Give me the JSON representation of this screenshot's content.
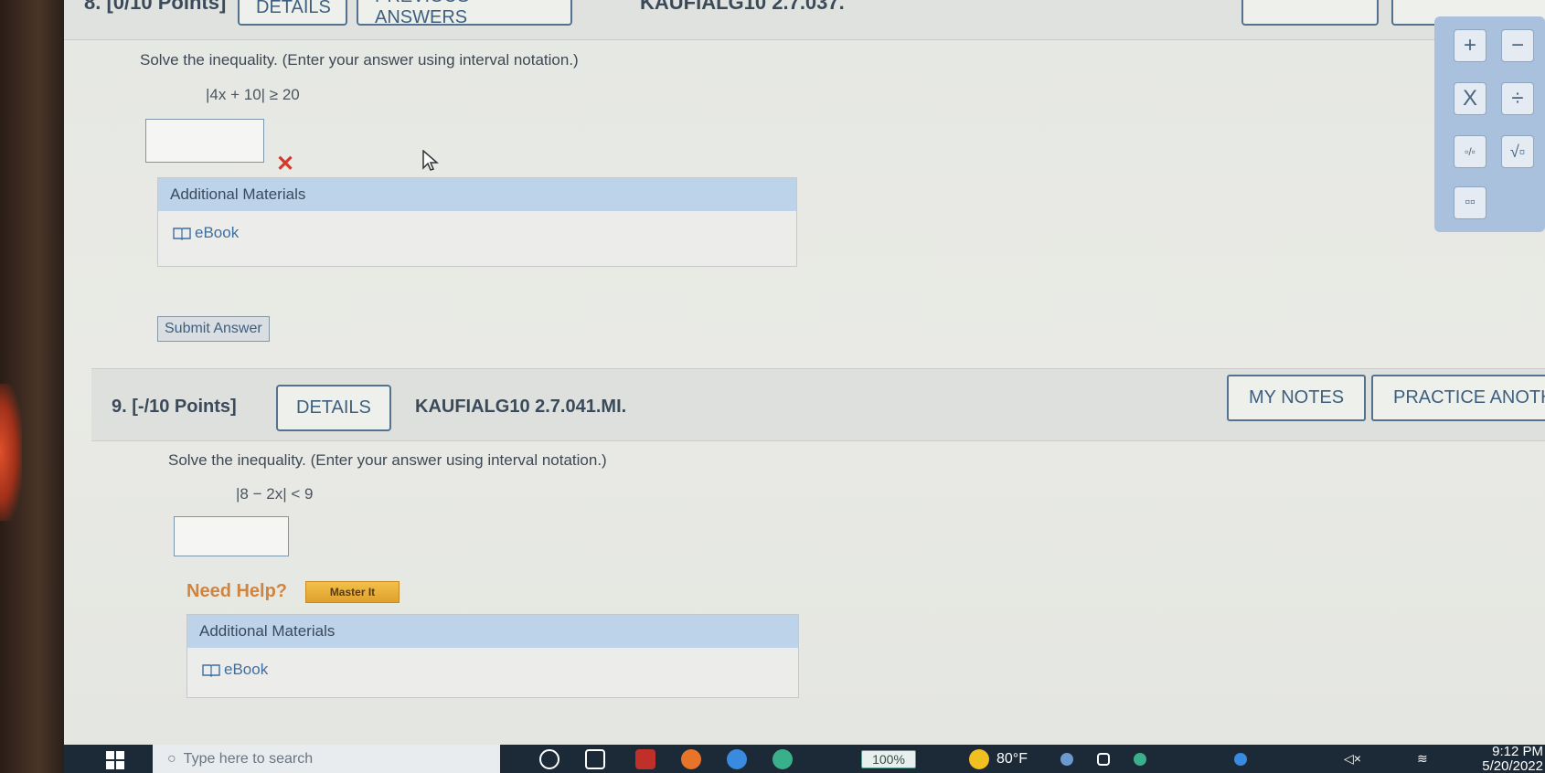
{
  "q8": {
    "points": "8. [0/10 Points]",
    "details_label": "DETAILS",
    "previous_label": "PREVIOUS ANSWERS",
    "code": "KAUFIALG10 2.7.037.",
    "prompt": "Solve the inequality. (Enter your answer using interval notation.)",
    "inequality": "|4x + 10| ≥ 20",
    "answer_value": "",
    "wrong_mark": "✕",
    "additional_materials": "Additional Materials",
    "ebook": "eBook",
    "submit_label": "Submit Answer"
  },
  "q9": {
    "number": "9.",
    "points": "[-/10 Points]",
    "details_label": "DETAILS",
    "code": "KAUFIALG10 2.7.041.MI.",
    "my_notes_label": "MY NOTES",
    "practice_label": "PRACTICE ANOTH",
    "prompt": "Solve the inequality. (Enter your answer using interval notation.)",
    "inequality": "|8 − 2x| < 9",
    "answer_value": "",
    "need_help": "Need Help?",
    "master_it": "Master It",
    "additional_materials": "Additional Materials",
    "ebook": "eBook"
  },
  "palette": {
    "plus": "+",
    "minus": "−",
    "times": "X",
    "divide": "÷",
    "fraction": "▫/▫",
    "sqrt": "√▫",
    "exponent": "▫▫"
  },
  "taskbar": {
    "search_placeholder": "Type here to search",
    "battery": "100%",
    "temperature": "80°F",
    "time": "9:12 PM",
    "date": "5/20/2022"
  },
  "colors": {
    "accent_blue": "#54718f",
    "wrong_red": "#d33a2a",
    "help_orange": "#d1843f",
    "header_blue": "#bcd3ea"
  }
}
